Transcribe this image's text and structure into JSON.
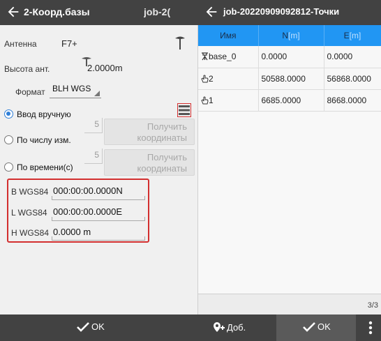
{
  "left": {
    "title": "2-Коорд.базы",
    "title2": "job-2(",
    "antenna_label": "Антенна",
    "antenna_value": "F7+",
    "height_label": "Высота ант.",
    "height_value": "2.0000m",
    "format_label": "Формат",
    "format_value": "BLH WGS",
    "radio_manual": "Ввод вручную",
    "radio_count": "По числу изм.",
    "radio_time": "По времени(с)",
    "count_value": "5",
    "time_value": "5",
    "get_btn_line1": "Получить",
    "get_btn_line2": "координаты",
    "b_label": "B WGS84",
    "b_value": "000:00:00.0000N",
    "l_label": "L WGS84",
    "l_value": "000:00:00.0000E",
    "h_label": "H WGS84",
    "h_value": "0.0000 m",
    "ok_label": "OK"
  },
  "right": {
    "title": "job-20220909092812-Точки",
    "columns": [
      {
        "name": "Имя",
        "unit": ""
      },
      {
        "name": "N",
        "unit": "[m]"
      },
      {
        "name": "E",
        "unit": "[m]"
      }
    ],
    "rows": [
      {
        "name": "base_0",
        "icon": "base-station-icon",
        "n": "0.0000",
        "e": "0.0000"
      },
      {
        "name": "2",
        "icon": "hand-point-icon",
        "n": "50588.0000",
        "e": "56868.0000"
      },
      {
        "name": "1",
        "icon": "hand-point-icon",
        "n": "6685.0000",
        "e": "8668.0000"
      }
    ],
    "pager": "3/3",
    "add_label": "Доб.",
    "ok_label": "OK"
  },
  "colors": {
    "toolbar": "#424242",
    "header_blue": "#2196f3",
    "highlight_red": "#d32f2f",
    "radio_blue": "#2f7fd8"
  }
}
